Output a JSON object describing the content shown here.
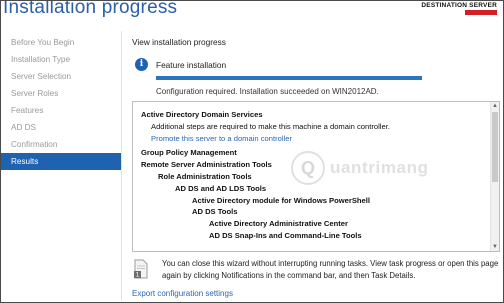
{
  "window": {
    "title": "Installation progress",
    "destination_label": "DESTINATION SERVER"
  },
  "nav": {
    "items": [
      {
        "label": "Before You Begin",
        "active": false
      },
      {
        "label": "Installation Type",
        "active": false
      },
      {
        "label": "Server Selection",
        "active": false
      },
      {
        "label": "Server Roles",
        "active": false
      },
      {
        "label": "Features",
        "active": false
      },
      {
        "label": "AD DS",
        "active": false
      },
      {
        "label": "Confirmation",
        "active": false
      },
      {
        "label": "Results",
        "active": true
      }
    ]
  },
  "main": {
    "heading": "View installation progress",
    "feature_label": "Feature installation",
    "info_icon": "info-icon",
    "progress": 1.0,
    "status_text": "Configuration required. Installation succeeded on WIN2012AD.",
    "results": {
      "ad_ds_title": "Active Directory Domain Services",
      "ad_ds_desc": "Additional steps are required to make this machine a domain controller.",
      "promote_link": "Promote this server to a domain controller",
      "gpm": "Group Policy Management",
      "rsat": "Remote Server Administration Tools",
      "role_tools": "Role Administration Tools",
      "ad_lds_tools": "AD DS and AD LDS Tools",
      "ps_module": "Active Directory module for Windows PowerShell",
      "ad_ds_tools": "AD DS Tools",
      "admin_center": "Active Directory Administrative Center",
      "snapins": "AD DS Snap-Ins and Command-Line Tools"
    },
    "note": "You can close this wizard without interrupting running tasks. View task progress or open this page again by clicking Notifications in the command bar, and then Task Details.",
    "note_badge": "1",
    "export_link": "Export configuration settings"
  },
  "watermark": {
    "text": "uantrimang"
  },
  "colors": {
    "accent": "#1f62b0",
    "title": "#2b5fa8",
    "link": "#2b66b3",
    "progress": "#2a74c0"
  }
}
